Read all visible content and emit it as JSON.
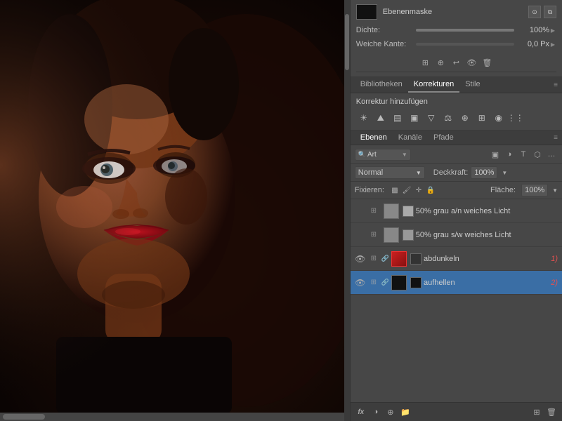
{
  "photo": {
    "alt": "Woman portrait with red lips and dramatic lighting"
  },
  "mask_section": {
    "title": "Ebenenmaske",
    "density_label": "Dichte:",
    "density_value": "100%",
    "soft_edge_label": "Weiche Kante:",
    "soft_edge_value": "0,0 Px"
  },
  "tabs": {
    "bibliotheken": "Bibliotheken",
    "korrekturen": "Korrekturen",
    "stile": "Stile"
  },
  "korrekturen_panel": {
    "title": "Korrektur hinzufügen"
  },
  "layers_tabs": {
    "ebenen": "Ebenen",
    "kanaele": "Kanäle",
    "pfade": "Pfade"
  },
  "layers_toolbar": {
    "search_placeholder": "Art"
  },
  "blend_mode": {
    "value": "Normal",
    "opacity_label": "Deckkraft:",
    "opacity_value": "100%"
  },
  "fix_row": {
    "label": "Fixieren:",
    "flache_label": "Fläche:",
    "flache_value": "100%"
  },
  "layers": [
    {
      "id": "layer-1",
      "name": "50% grau a/n weiches Licht",
      "visible": false,
      "thumb_color": "#888",
      "mask_color": "#aaa",
      "selected": false,
      "badge": ""
    },
    {
      "id": "layer-2",
      "name": "50% grau s/w weiches Licht",
      "visible": false,
      "thumb_color": "#888",
      "mask_color": "#999",
      "selected": false,
      "badge": ""
    },
    {
      "id": "layer-3",
      "name": "abdunkeln",
      "visible": true,
      "thumb_color": "#c44",
      "mask_color": "#333",
      "selected": false,
      "badge": "1)"
    },
    {
      "id": "layer-4",
      "name": "aufhellen",
      "visible": true,
      "thumb_color": "#111",
      "mask_color": "#111",
      "selected": true,
      "badge": "2)"
    }
  ],
  "bottom_toolbar": {
    "fx_label": "fx",
    "icons": [
      "fx",
      "◑",
      "⊞",
      "📁",
      "🗑"
    ]
  }
}
